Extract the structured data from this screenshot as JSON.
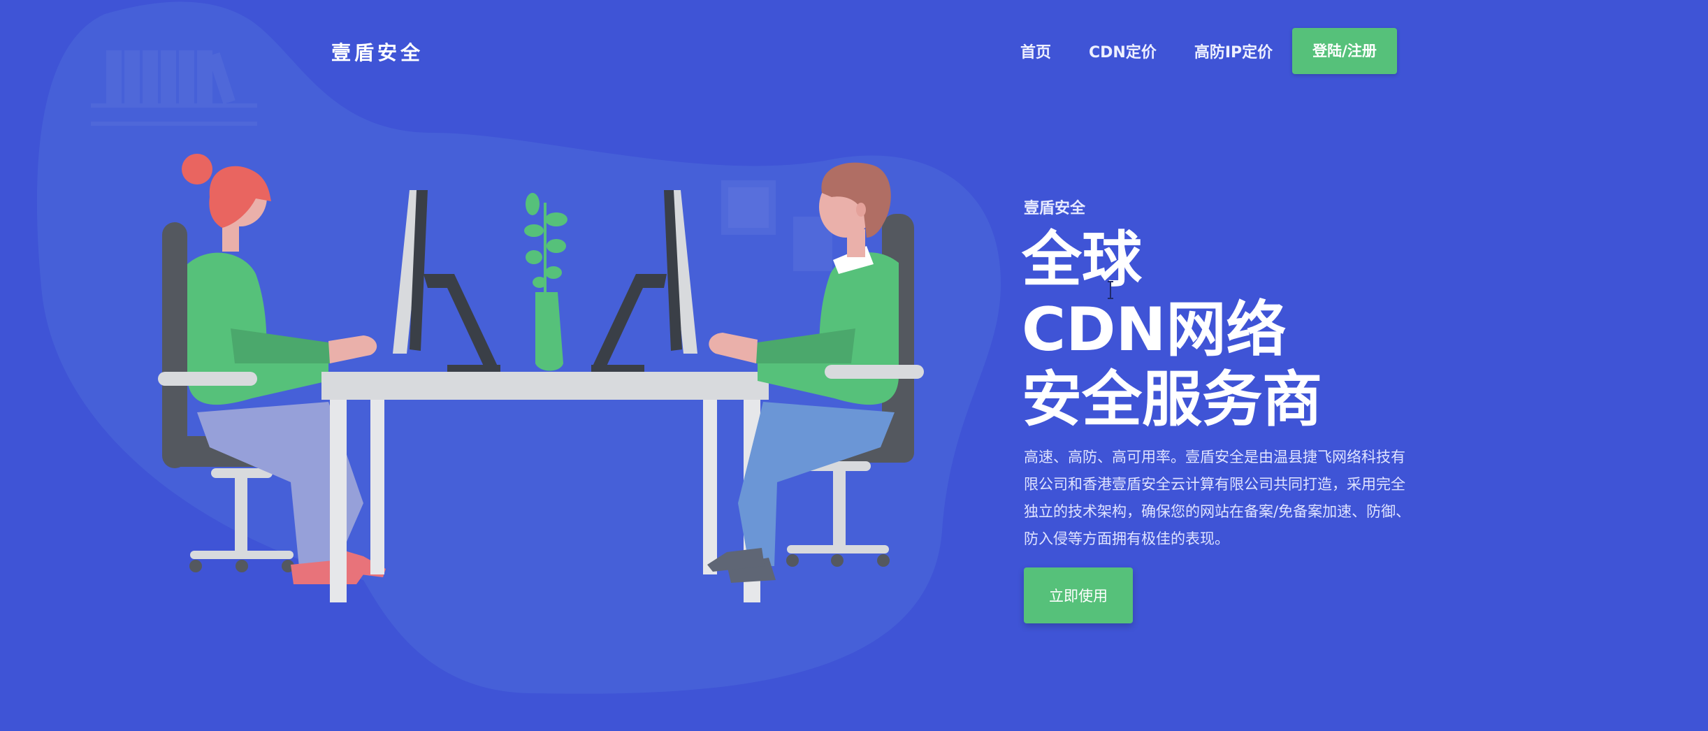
{
  "header": {
    "brand": "壹盾安全",
    "nav": [
      {
        "label": "首页"
      },
      {
        "label": "CDN定价"
      },
      {
        "label": "高防IP定价"
      }
    ],
    "login_label": "登陆/注册"
  },
  "hero": {
    "eyebrow": "壹盾安全",
    "title_lines": [
      "全球",
      "CDN网络",
      "安全服务商"
    ],
    "description": "高速、高防、高可用率。壹盾安全是由温县捷飞网络科技有限公司和香港壹盾安全云计算有限公司共同打造，采用完全独立的技术架构，确保您的网站在备案/免备案加速、防御、防入侵等方面拥有极佳的表现。",
    "cta_label": "立即使用"
  },
  "colors": {
    "background": "#3f54d6",
    "accent_green": "#56c17a",
    "blob": "#4660d8"
  },
  "icons": [
    "bookshelf-icon",
    "picture-frame-icon",
    "text-cursor-icon"
  ]
}
